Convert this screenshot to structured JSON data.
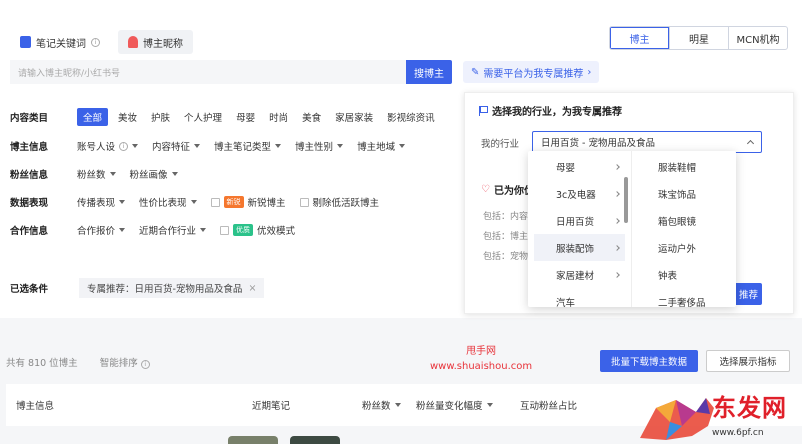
{
  "tabs": {
    "keyword": "笔记关键词",
    "nickname": "博主昵称"
  },
  "segment": [
    "博主",
    "明星",
    "MCN机构"
  ],
  "search": {
    "placeholder": "请输入博主昵称/小红书号",
    "button": "搜博主",
    "recommend_link": "需要平台为我专属推荐"
  },
  "filters": {
    "content_category": {
      "label": "内容类目",
      "items": [
        "全部",
        "美妆",
        "护肤",
        "个人护理",
        "母婴",
        "时尚",
        "美食",
        "家居家装",
        "影视综资讯"
      ]
    },
    "blogger_info": {
      "label": "博主信息",
      "items": [
        "账号人设",
        "内容特征",
        "博主笔记类型",
        "博主性别",
        "博主地域"
      ]
    },
    "fans_info": {
      "label": "粉丝信息",
      "items": [
        "粉丝数",
        "粉丝画像"
      ]
    },
    "data_perf": {
      "label": "数据表现",
      "items": [
        "传播表现",
        "性价比表现"
      ],
      "new_badge": "新锐",
      "new_label": "新锐博主",
      "remove_label": "剔除低活跃博主"
    },
    "coop_info": {
      "label": "合作信息",
      "items": [
        "合作报价",
        "近期合作行业"
      ],
      "quality_badge": "优质",
      "quality_label": "优效模式"
    }
  },
  "chosen": {
    "label": "已选条件",
    "chip": "专属推荐：日用百货-宠物用品及食品",
    "close": "×"
  },
  "panel": {
    "title": "选择我的行业，为我专属推荐",
    "industry_label": "我的行业",
    "industry_value": "日用百货 - 宠物用品及食品",
    "guess_title": "已为你优",
    "include_lines": [
      "包括：内容",
      "包括：博主",
      "包括：宠物"
    ],
    "button": "推荐"
  },
  "cascader": {
    "level1": [
      "母婴",
      "3c及电器",
      "日用百货",
      "服装配饰",
      "家居建材",
      "汽车"
    ],
    "level2": [
      "服装鞋帽",
      "珠宝饰品",
      "箱包眼镜",
      "运动户外",
      "钟表",
      "二手奢侈品"
    ]
  },
  "results": {
    "count": "共有 810 位博主",
    "sort": "智能排序",
    "download": "批量下载博主数据",
    "select_metrics": "选择展示指标"
  },
  "table": {
    "headers": [
      "博主信息",
      "近期笔记",
      "粉丝数",
      "粉丝量变化幅度",
      "互动粉丝占比"
    ]
  },
  "watermark": {
    "line1": "甩手网",
    "line2": "www.shuaishou.com",
    "logo_text": "东发网",
    "logo_url": "www.6pf.cn"
  },
  "colors": {
    "accent": "#3b62e8",
    "watermark_red": "#e8333a"
  }
}
